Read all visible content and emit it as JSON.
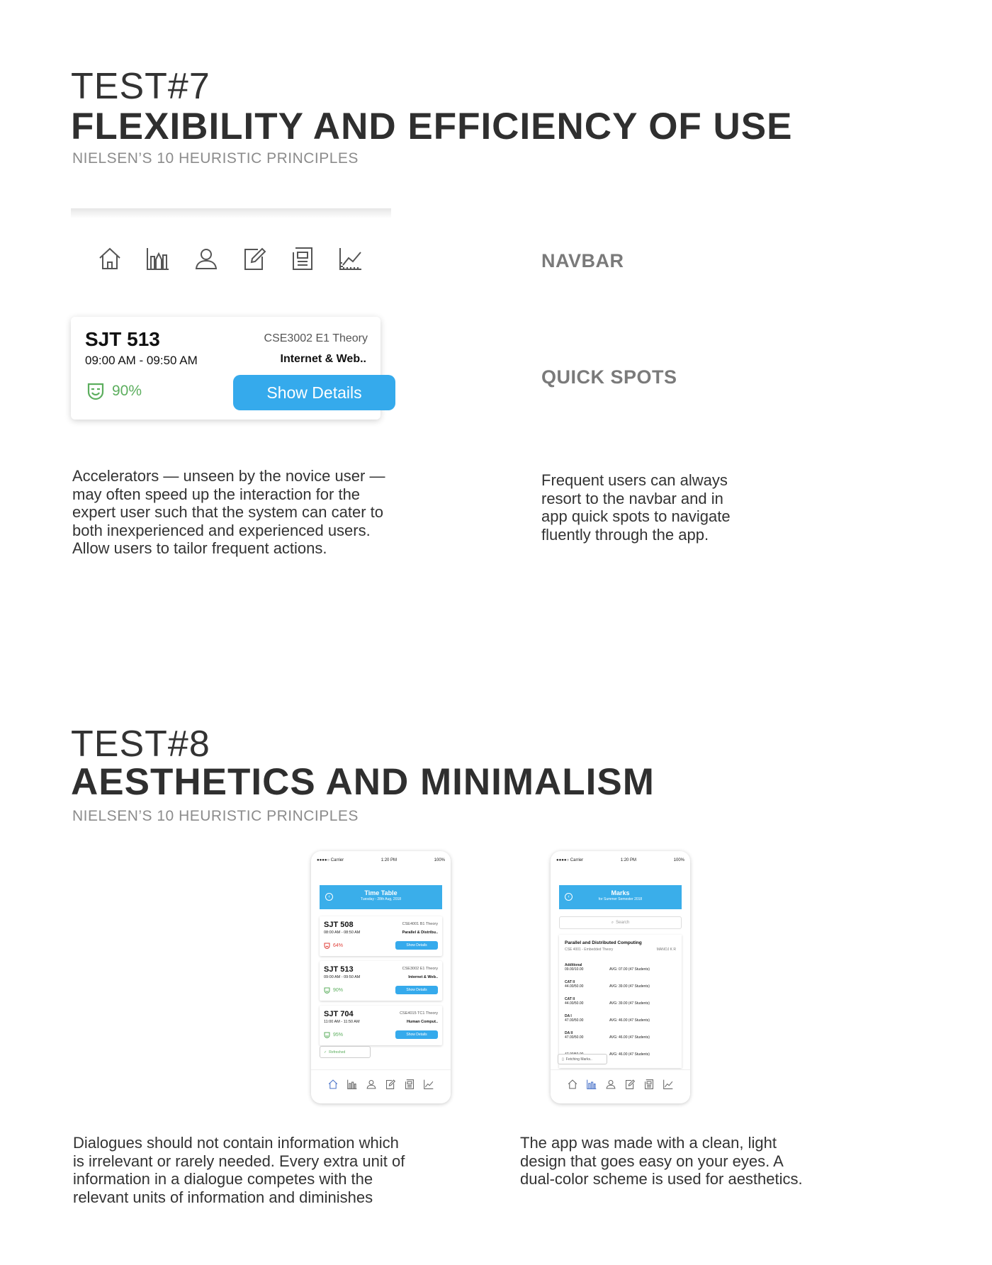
{
  "test7": {
    "number": "TEST#7",
    "title": "FLEXIBILITY AND EFFICIENCY OF USE",
    "subtitle": "NIELSEN’S  10 HEURISTIC PRINCIPLES",
    "navbar_label": "NAVBAR",
    "quick_spots_label": "QUICK SPOTS",
    "nav_icons": [
      "home-icon",
      "chart-icon",
      "user-icon",
      "edit-icon",
      "document-icon",
      "trend-icon"
    ],
    "card": {
      "room": "SJT 513",
      "time": "09:00 AM - 09:50 AM",
      "course": "CSE3002 E1 Theory",
      "name": "Internet & Web..",
      "attendance": "90%",
      "button": "Show Details"
    },
    "para_left": [
      "Accelerators — unseen by the novice user —",
      "may often speed up the interaction for the",
      "expert user such that the system can cater to",
      "both inexperienced and experienced users.",
      "Allow users to tailor frequent actions."
    ],
    "para_right": [
      "Frequent users can always",
      "resort to the navbar and in",
      "app quick spots to navigate",
      "fluently through the app."
    ]
  },
  "test8": {
    "number": "TEST#8",
    "title": "AESTHETICS AND MINIMALISM",
    "subtitle": "NIELSEN’S  10 HEURISTIC PRINCIPLES",
    "para_left": [
      "Dialogues should not contain information which",
      "is irrelevant or rarely needed. Every extra unit of",
      "information in a dialogue competes with the",
      "relevant units of information and diminishes"
    ],
    "para_right": [
      "The app was made with a clean, light",
      "design that goes easy on your eyes. A",
      "dual-color scheme is used for aesthetics."
    ]
  },
  "phone1": {
    "carrier": "●●●●○ Carrier",
    "time": "1:20 PM",
    "battery": "100%",
    "header_title": "Time Table",
    "header_sub": "Tuesday - 28th Aug, 2018",
    "cards": [
      {
        "room": "SJT 508",
        "time": "08:00 AM - 08:50 AM",
        "course": "CSE4001 B1 Theory",
        "name": "Parallel & Distribu..",
        "attendance": "64%",
        "button": "Show Details"
      },
      {
        "room": "SJT 513",
        "time": "09:00 AM - 09:50 AM",
        "course": "CSE3002 E1 Theory",
        "name": "Internet & Web..",
        "attendance": "90%",
        "button": "Show Details"
      },
      {
        "room": "SJT 704",
        "time": "11:00 AM - 11:50 AM",
        "course": "CSE4015 TC1 Theory",
        "name": "Human Comput..",
        "attendance": "95%",
        "button": "Show Details"
      }
    ],
    "toast": "Refreshed"
  },
  "phone2": {
    "carrier": "●●●●○ Carrier",
    "time": "1:20 PM",
    "battery": "100%",
    "header_title": "Marks",
    "header_sub": "for Summer Semester 2018",
    "search_placeholder": "Search",
    "course_title": "Parallel and Distributed Computing",
    "course_sub": "CSE 4001 - Embedded Theory",
    "faculty": "MANOJ K R",
    "rows": [
      {
        "name": "Additional",
        "score": "09.00/10.00",
        "avg": "AVG: 07.00 (47 Students)"
      },
      {
        "name": "CAT II",
        "score": "44.00/50.00",
        "avg": "AVG: 39.00 (47 Students)"
      },
      {
        "name": "CAT II",
        "score": "44.00/50.00",
        "avg": "AVG: 39.00 (47 Students)"
      },
      {
        "name": "DA I",
        "score": "47.00/50.00",
        "avg": "AVG: 46.00 (47 Students)"
      },
      {
        "name": "DA II",
        "score": "47.00/50.00",
        "avg": "AVG: 46.00 (47 Students)"
      },
      {
        "name": "",
        "score": "47.00/50.00",
        "avg": "AVG: 46.00 (47 Students)"
      }
    ],
    "toast": "Fetching Marks.."
  }
}
